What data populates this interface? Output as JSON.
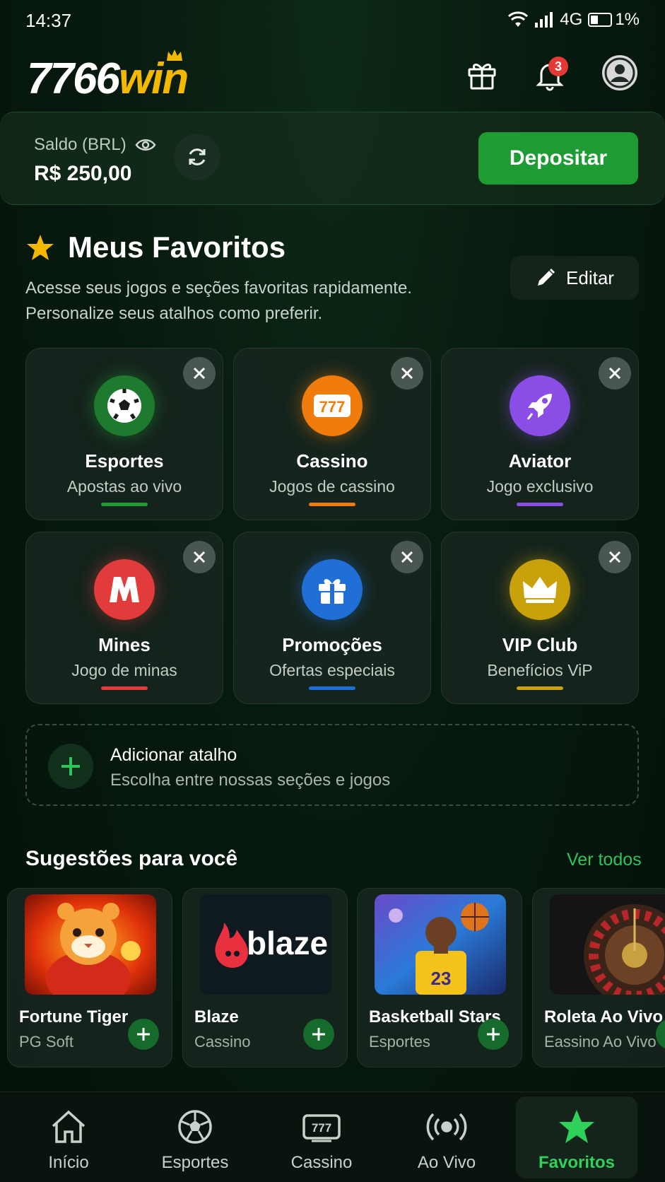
{
  "status_bar": {
    "time": "14:37",
    "network": "4G",
    "battery": "1%"
  },
  "header": {
    "logo_number": "7766",
    "logo_word": "win",
    "notification_count": "3"
  },
  "balance": {
    "label": "Saldo (BRL)",
    "value": "R$ 250,00",
    "deposit_label": "Depositar"
  },
  "favorites": {
    "title": "Meus Favoritos",
    "description_line1": "Acesse seus jogos e seções favoritas rapidamente.",
    "description_line2": "Personalize seus atalhos como preferir.",
    "edit_label": "Editar",
    "tiles": [
      {
        "name": "Esportes",
        "sub": "Apostas ao vivo",
        "icon": "soccer-ball-icon",
        "color": "#1f9b33"
      },
      {
        "name": "Cassino",
        "sub": "Jogos de cassino",
        "icon": "slot-777-icon",
        "color": "#f07c0c"
      },
      {
        "name": "Aviator",
        "sub": "Jogo exclusivo",
        "icon": "rocket-icon",
        "color": "#8a4ee6"
      },
      {
        "name": "Mines",
        "sub": "Jogo de minas",
        "icon": "mines-m-icon",
        "color": "#e23b3b"
      },
      {
        "name": "Promoções",
        "sub": "Ofertas especiais",
        "icon": "gift-icon",
        "color": "#1f6fd6"
      },
      {
        "name": "VIP Club",
        "sub": "Benefícios ViP",
        "icon": "crown-icon",
        "color": "#c9a10b"
      }
    ],
    "add_shortcut_title": "Adicionar atalho",
    "add_shortcut_sub": "Escolha entre nossas seções e jogos"
  },
  "suggestions": {
    "title": "Sugestões para você",
    "see_all": "Ver todos",
    "items": [
      {
        "name": "Fortune Tiger",
        "sub": "PG Soft"
      },
      {
        "name": "Blaze",
        "sub": "Cassino",
        "logo_text": "blaze"
      },
      {
        "name": "Basketball Stars",
        "sub": "Esportes"
      },
      {
        "name": "Roleta Ao Vivo",
        "sub": "Eassino Ao Vivo"
      }
    ]
  },
  "bottom_nav": [
    {
      "label": "Início",
      "icon": "home-icon"
    },
    {
      "label": "Esportes",
      "icon": "soccer-ball-icon"
    },
    {
      "label": "Cassino",
      "icon": "slot-777-icon"
    },
    {
      "label": "Ao Vivo",
      "icon": "live-broadcast-icon"
    },
    {
      "label": "Favoritos",
      "icon": "star-icon",
      "active": true
    }
  ],
  "colors": {
    "accent_green": "#1f9b33",
    "link_green": "#2fc35a",
    "logo_gold": "#f5b800"
  }
}
